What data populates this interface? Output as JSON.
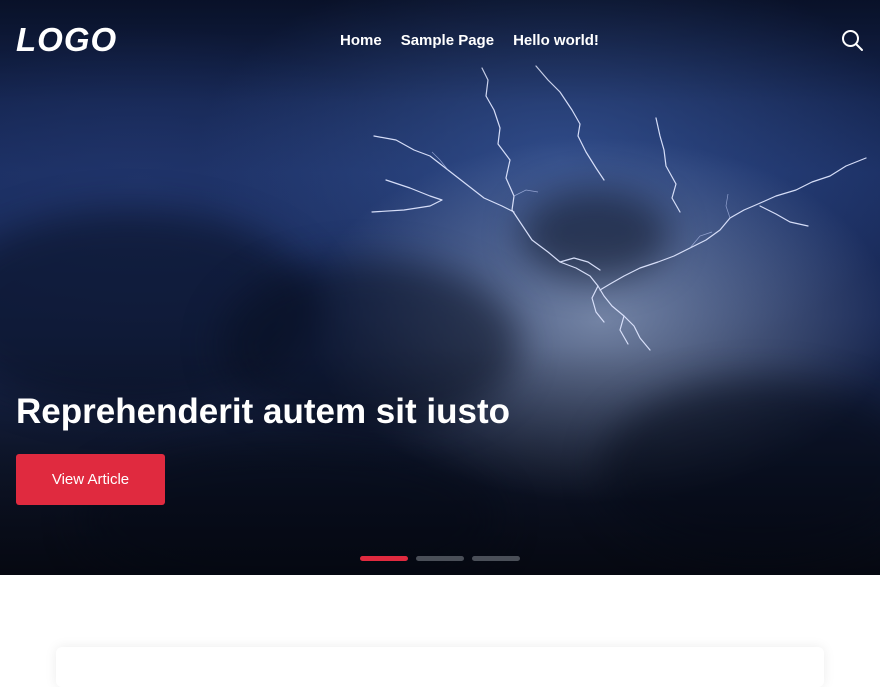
{
  "site": {
    "logo": "LOGO"
  },
  "nav": {
    "items": [
      {
        "label": "Home"
      },
      {
        "label": "Sample Page"
      },
      {
        "label": "Hello world!"
      }
    ]
  },
  "search": {
    "icon": "search-icon"
  },
  "hero": {
    "title": "Reprehenderit autem sit iusto",
    "cta_label": "View Article",
    "slides_count": 3,
    "active_slide": 1
  },
  "colors": {
    "accent": "#e02a3f",
    "dot_inactive": "#4a4f58",
    "text_on_dark": "#ffffff"
  }
}
